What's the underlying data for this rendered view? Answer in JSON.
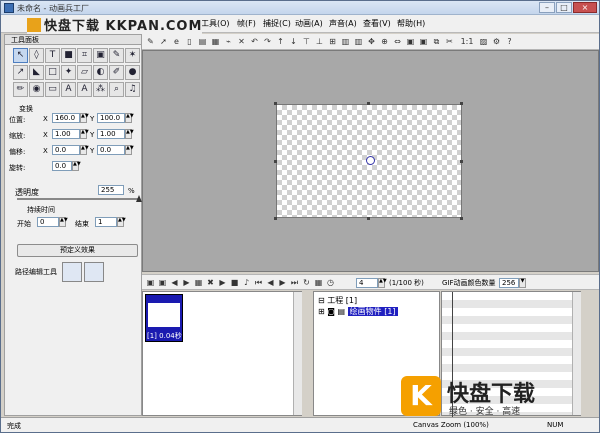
{
  "title": "未命名 - 动画兵工厂",
  "watermark_top": "快盘下载 KKPAN.COM",
  "menu": [
    "工具(O)",
    "帧(F)",
    "捕捉(C)",
    "动画(A)",
    "声音(A)",
    "查看(V)",
    "帮助(H)"
  ],
  "left_panel": {
    "header": "工具面板",
    "transform_label": "变换",
    "position_label": "位置:",
    "scale_label": "缩放:",
    "skew_label": "偏移:",
    "rotate_label": "旋转:",
    "x": "X",
    "y": "Y",
    "pos_x": "160.0",
    "pos_y": "100.0",
    "scale_x": "1.00",
    "scale_y": "1.00",
    "skew_x": "0.0",
    "skew_y": "0.0",
    "rotate": "0.0",
    "opacity_label": "透明度",
    "opacity_value": "255",
    "opacity_unit": "%",
    "duration_label": "持续时间",
    "start_label": "开始",
    "start_value": "0",
    "end_label": "结束",
    "end_value": "1",
    "custom_effect_button": "预定义效果",
    "path_tool_label": "路径编辑工具"
  },
  "toolbar_right": {
    "ratio": "1:1"
  },
  "timeline": {
    "frame_value": "4",
    "frame_rate": "(1/100 秒)",
    "gif_color_label": "GIF动画颜色数量",
    "gif_color_value": "256",
    "frame_label": "[1] 0.04秒",
    "project_label": "工程 [1]",
    "object_label": "绘画物件 [1]"
  },
  "status": {
    "left": "完成",
    "zoom": "Canvas Zoom (100%)",
    "num": "NUM"
  },
  "watermark_bottom": {
    "logo_char": "K",
    "title": "快盘下载",
    "slogan": "绿色 · 安全 · 高速"
  }
}
